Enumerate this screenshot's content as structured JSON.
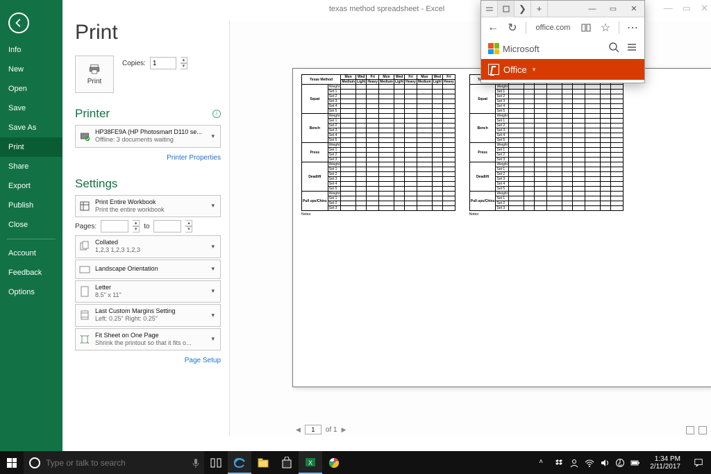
{
  "title_bar": "texas method spreadsheet  -  Excel",
  "sidebar": {
    "items": [
      "Info",
      "New",
      "Open",
      "Save",
      "Save As",
      "Print",
      "Share",
      "Export",
      "Publish",
      "Close"
    ],
    "selected": 5,
    "bottom": [
      "Account",
      "Feedback",
      "Options"
    ]
  },
  "print": {
    "heading": "Print",
    "print_btn": "Print",
    "copies_label": "Copies:",
    "copies_value": "1",
    "printer_heading": "Printer",
    "printer_name": "HP38FE9A (HP Photosmart D110 se...",
    "printer_status": "Offline: 3 documents waiting",
    "printer_props": "Printer Properties",
    "settings_heading": "Settings",
    "settings": [
      {
        "l1": "Print Entire Workbook",
        "l2": "Print the entire workbook"
      },
      {
        "l1": "Collated",
        "l2": "1,2,3    1,2,3    1,2,3"
      },
      {
        "l1": "Landscape Orientation",
        "l2": ""
      },
      {
        "l1": "Letter",
        "l2": "8.5\" x 11\""
      },
      {
        "l1": "Last Custom Margins Setting",
        "l2": "Left:  0.25\"    Right:  0.25\""
      },
      {
        "l1": "Fit Sheet on One Page",
        "l2": "Shrink the printout so that it fits o..."
      }
    ],
    "pages_label": "Pages:",
    "pages_to": "to",
    "page_setup": "Page Setup"
  },
  "preview": {
    "page_current": "1",
    "page_of": "of  1",
    "sheet_title": "Texas Method",
    "days": [
      "Mon",
      "Wed",
      "Fri",
      "Mon",
      "Wed",
      "Fri",
      "Mon",
      "Wed",
      "Fri"
    ],
    "intens": [
      "Medium",
      "Light",
      "Heavy",
      "Medium",
      "Light",
      "Heavy",
      "Medium",
      "Light",
      "Heavy"
    ],
    "exercises": [
      {
        "name": "Squat",
        "rows": [
          "Weight",
          "Set 1",
          "Set 2",
          "Set 3",
          "Set 4",
          "Set 5"
        ]
      },
      {
        "name": "Bench",
        "rows": [
          "Weight",
          "Set 1",
          "Set 2",
          "Set 3",
          "Set 4",
          "Set 5"
        ]
      },
      {
        "name": "Press",
        "rows": [
          "Weight",
          "Set 1",
          "Set 2",
          "Set 3"
        ]
      },
      {
        "name": "Deadlift",
        "rows": [
          "Weight",
          "Set 1",
          "Set 2",
          "Set 3",
          "Set 4",
          "Set 5"
        ]
      },
      {
        "name": "Pull ups/Chins",
        "rows": [
          "Weight",
          "Set 1",
          "Set 2",
          "Set 3"
        ]
      }
    ],
    "notes": "Notes:"
  },
  "edge": {
    "url": "office.com",
    "ms": "Microsoft",
    "office": "Office"
  },
  "taskbar": {
    "search_placeholder": "Type or talk to search",
    "time": "1:34 PM",
    "date": "2/11/2017"
  }
}
